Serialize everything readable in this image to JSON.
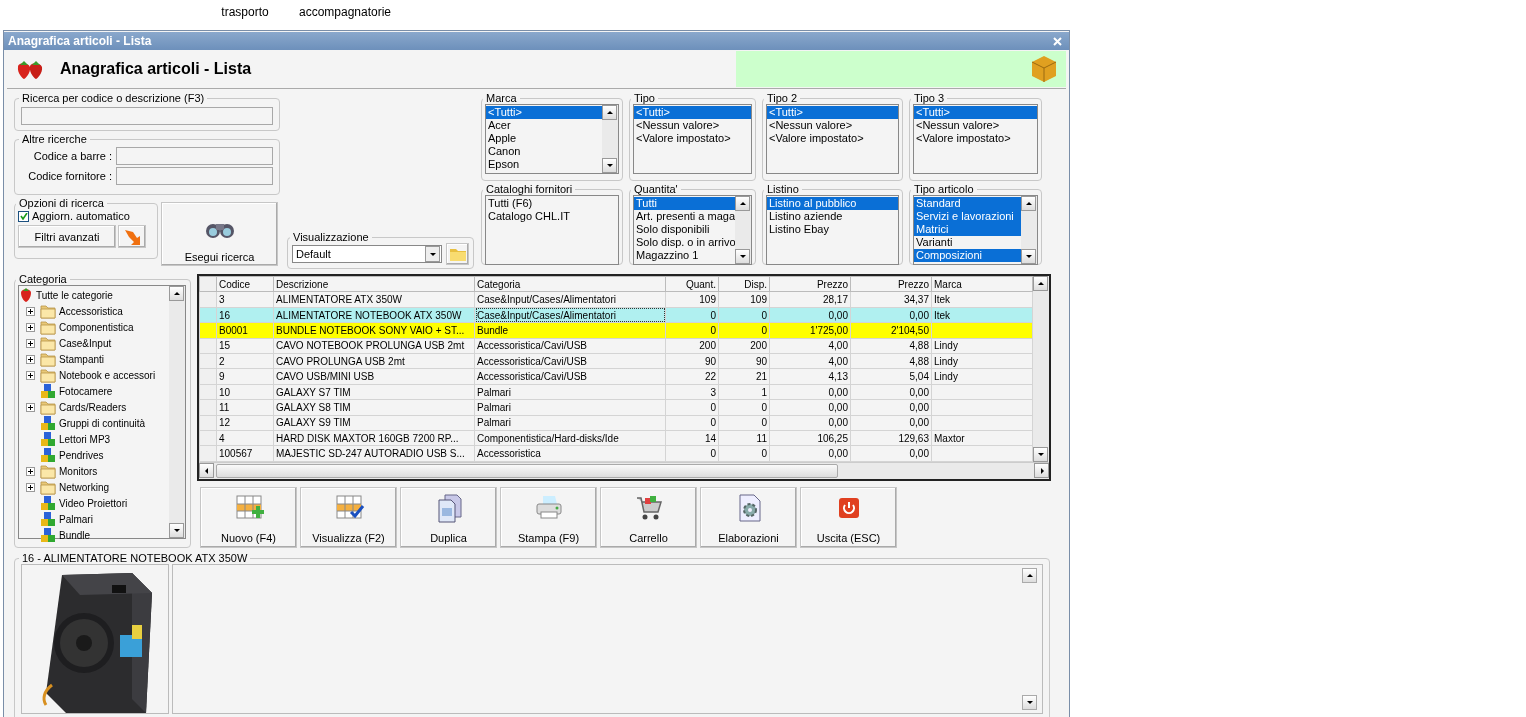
{
  "toolbar": [
    {
      "label": "trasporto"
    },
    {
      "label": "accompagnatorie"
    }
  ],
  "window": {
    "title": "Anagrafica articoli  - Lista"
  },
  "header": {
    "title": "Anagrafica articoli  - Lista"
  },
  "search": {
    "title": "Ricerca per codice o descrizione (F3)"
  },
  "other_searches": {
    "title": "Altre ricerche",
    "fields": [
      {
        "label": "Codice a barre :"
      },
      {
        "label": "Codice fornitore :"
      }
    ]
  },
  "options": {
    "title": "Opzioni di ricerca",
    "auto_update": {
      "label": "Aggiorn. automatico",
      "checked": true
    },
    "advanced_button": "Filtri avanzati"
  },
  "search_button": "Esegui ricerca",
  "view": {
    "title": "Visualizzazione",
    "value": "Default"
  },
  "filters": [
    {
      "title": "Marca",
      "scrollable": true,
      "items": [
        {
          "label": "<Tutti>",
          "selected": true
        },
        {
          "label": "Acer",
          "selected": false
        },
        {
          "label": "Apple",
          "selected": false
        },
        {
          "label": "Canon",
          "selected": false
        },
        {
          "label": "Epson",
          "selected": false
        }
      ]
    },
    {
      "title": "Tipo",
      "scrollable": false,
      "items": [
        {
          "label": "<Tutti>",
          "selected": true
        },
        {
          "label": "<Nessun valore>",
          "selected": false
        },
        {
          "label": "<Valore impostato>",
          "selected": false
        }
      ]
    },
    {
      "title": "Tipo 2",
      "scrollable": false,
      "items": [
        {
          "label": "<Tutti>",
          "selected": true
        },
        {
          "label": "<Nessun valore>",
          "selected": false
        },
        {
          "label": "<Valore impostato>",
          "selected": false
        }
      ]
    },
    {
      "title": "Tipo 3",
      "scrollable": false,
      "items": [
        {
          "label": "<Tutti>",
          "selected": true
        },
        {
          "label": "<Nessun valore>",
          "selected": false
        },
        {
          "label": "<Valore impostato>",
          "selected": false
        }
      ]
    },
    {
      "title": "Cataloghi fornitori",
      "scrollable": false,
      "items": [
        {
          "label": "Tutti (F6)",
          "selected": false
        },
        {
          "label": "Catalogo CHL.IT",
          "selected": false
        }
      ]
    },
    {
      "title": "Quantita'",
      "scrollable": true,
      "items": [
        {
          "label": "Tutti",
          "selected": true
        },
        {
          "label": "Art. presenti a maga",
          "selected": false
        },
        {
          "label": "Solo disponibili",
          "selected": false
        },
        {
          "label": "Solo disp. o in arrivo",
          "selected": false
        },
        {
          "label": "Magazzino 1",
          "selected": false
        }
      ]
    },
    {
      "title": "Listino",
      "scrollable": false,
      "items": [
        {
          "label": "Listino al pubblico",
          "selected": true
        },
        {
          "label": "Listino aziende",
          "selected": false
        },
        {
          "label": "Listino Ebay",
          "selected": false
        }
      ]
    },
    {
      "title": "Tipo articolo",
      "scrollable": true,
      "items": [
        {
          "label": "Standard",
          "selected": true
        },
        {
          "label": "Servizi e lavorazioni",
          "selected": true
        },
        {
          "label": "Matrici",
          "selected": true
        },
        {
          "label": "Varianti",
          "selected": false
        },
        {
          "label": "Composizioni",
          "selected": true
        }
      ]
    }
  ],
  "categories": {
    "title": "Categoria",
    "tree": [
      {
        "label": "Tutte le categorie",
        "kind": "root",
        "children": [
          {
            "label": "Accessoristica",
            "kind": "folder",
            "expanded": false
          },
          {
            "label": "Componentistica",
            "kind": "folder",
            "expanded": false
          },
          {
            "label": "Case&Input",
            "kind": "folder",
            "expanded": false
          },
          {
            "label": "Stampanti",
            "kind": "folder",
            "expanded": false
          },
          {
            "label": "Notebook e accessori",
            "kind": "folder",
            "expanded": false
          },
          {
            "label": "Fotocamere",
            "kind": "group"
          },
          {
            "label": "Cards/Readers",
            "kind": "folder",
            "expanded": false
          },
          {
            "label": "Gruppi di continuità",
            "kind": "group"
          },
          {
            "label": "Lettori MP3",
            "kind": "group"
          },
          {
            "label": "Pendrives",
            "kind": "group"
          },
          {
            "label": "Monitors",
            "kind": "folder",
            "expanded": false
          },
          {
            "label": "Networking",
            "kind": "folder",
            "expanded": false
          },
          {
            "label": "Video Proiettori",
            "kind": "group"
          },
          {
            "label": "Palmari",
            "kind": "group"
          },
          {
            "label": "Bundle",
            "kind": "group"
          }
        ]
      }
    ]
  },
  "table": {
    "columns": [
      "Codice",
      "Descrizione",
      "Categoria",
      "Quant.",
      "Disp.",
      "Prezzo",
      "Prezzo",
      "Marca"
    ],
    "rows": [
      {
        "selected": false,
        "highlighted": false,
        "cells": [
          "3",
          "ALIMENTATORE ATX 350W",
          "Case&Input/Cases/Alimentatori",
          "109",
          "109",
          "28,17",
          "34,37",
          "Itek"
        ]
      },
      {
        "selected": true,
        "highlighted": false,
        "cells": [
          "16",
          "ALIMENTATORE NOTEBOOK ATX 350W",
          "Case&Input/Cases/Alimentatori",
          "0",
          "0",
          "0,00",
          "0,00",
          "Itek"
        ]
      },
      {
        "selected": false,
        "highlighted": true,
        "cells": [
          "B0001",
          "BUNDLE NOTEBOOK SONY VAIO + ST...",
          "Bundle",
          "0",
          "0",
          "1'725,00",
          "2'104,50",
          ""
        ]
      },
      {
        "selected": false,
        "highlighted": false,
        "cells": [
          "15",
          "CAVO NOTEBOOK PROLUNGA USB 2mt",
          "Accessoristica/Cavi/USB",
          "200",
          "200",
          "4,00",
          "4,88",
          "Lindy"
        ]
      },
      {
        "selected": false,
        "highlighted": false,
        "cells": [
          "2",
          "CAVO PROLUNGA USB 2mt",
          "Accessoristica/Cavi/USB",
          "90",
          "90",
          "4,00",
          "4,88",
          "Lindy"
        ]
      },
      {
        "selected": false,
        "highlighted": false,
        "cells": [
          "9",
          "CAVO USB/MINI USB",
          "Accessoristica/Cavi/USB",
          "22",
          "21",
          "4,13",
          "5,04",
          "Lindy"
        ]
      },
      {
        "selected": false,
        "highlighted": false,
        "cells": [
          "10",
          "GALAXY S7 TIM",
          "Palmari",
          "3",
          "1",
          "0,00",
          "0,00",
          ""
        ]
      },
      {
        "selected": false,
        "highlighted": false,
        "cells": [
          "11",
          "GALAXY S8 TIM",
          "Palmari",
          "0",
          "0",
          "0,00",
          "0,00",
          ""
        ]
      },
      {
        "selected": false,
        "highlighted": false,
        "cells": [
          "12",
          "GALAXY S9 TIM",
          "Palmari",
          "0",
          "0",
          "0,00",
          "0,00",
          ""
        ]
      },
      {
        "selected": false,
        "highlighted": false,
        "cells": [
          "4",
          "HARD DISK MAXTOR 160GB 7200 RP...",
          "Componentistica/Hard-disks/Ide",
          "14",
          "11",
          "106,25",
          "129,63",
          "Maxtor"
        ]
      },
      {
        "selected": false,
        "highlighted": false,
        "cells": [
          "100567",
          "MAJESTIC SD-247 AUTORADIO USB S...",
          "Accessoristica",
          "0",
          "0",
          "0,00",
          "0,00",
          ""
        ]
      }
    ]
  },
  "actions": [
    {
      "label": "Nuovo (F4)",
      "kind": "new"
    },
    {
      "label": "Visualizza (F2)",
      "kind": "view"
    },
    {
      "label": "Duplica",
      "kind": "duplicate"
    },
    {
      "label": "Stampa (F9)",
      "kind": "print"
    },
    {
      "label": "Carrello",
      "kind": "cart"
    },
    {
      "label": "Elaborazioni",
      "kind": "process"
    },
    {
      "label": "Uscita (ESC)",
      "kind": "exit"
    }
  ],
  "detail": {
    "title": "16 - ALIMENTATORE NOTEBOOK ATX 350W"
  }
}
